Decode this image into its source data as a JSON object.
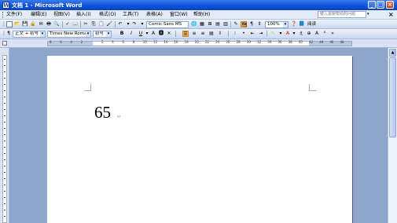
{
  "window": {
    "title": "文档 1 - Microsoft Word",
    "icon_glyph": "W"
  },
  "menu": {
    "items": [
      "文件(F)",
      "编辑(E)",
      "视图(V)",
      "插入(I)",
      "格式(O)",
      "工具(T)",
      "表格(A)",
      "窗口(W)",
      "帮助(H)"
    ],
    "help_placeholder": "键入需要帮助的问题",
    "close_glyph": "×"
  },
  "toolbar1": {
    "font_combo": "Comic Sans MS",
    "zoom": "100%",
    "read_label": "阅读"
  },
  "toolbar2": {
    "style_combo": "正文 + 初号",
    "font_name": "Times New Roman",
    "font_size": "初号",
    "bold": "B",
    "italic": "I",
    "underline": "U",
    "char_a": "A",
    "font_color_a": "A"
  },
  "ruler": {
    "numbers": [
      "8",
      "6",
      "4",
      "2",
      "",
      "2",
      "4",
      "6",
      "8",
      "10",
      "12",
      "14",
      "16",
      "18",
      "20",
      "22",
      "24",
      "26",
      "28",
      "30",
      "32",
      "34",
      "36",
      "38",
      "40",
      "42",
      "44",
      "46",
      "48"
    ]
  },
  "document": {
    "text": "65",
    "paragraph_mark": "↵"
  },
  "colors": {
    "titlebar": "#0d4fd8",
    "workspace": "#8fa6cc",
    "highlight": "#f7c160"
  }
}
